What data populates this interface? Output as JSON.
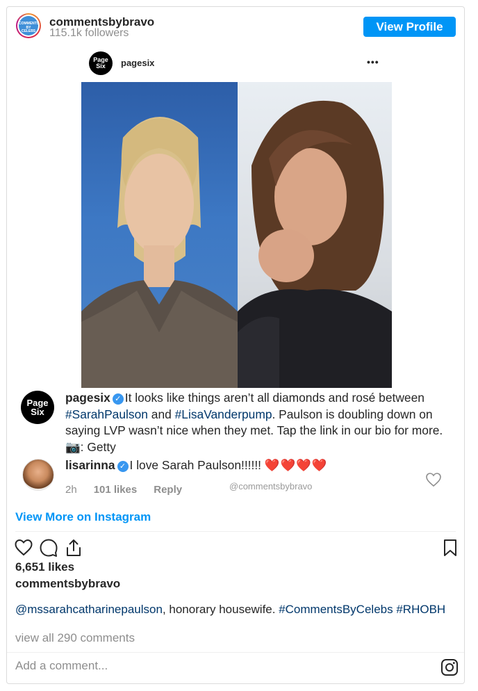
{
  "header": {
    "username": "commentsbybravo",
    "followers": "115.1k followers",
    "avatar_text": "COMMENTS BY CELEBS",
    "view_profile_label": "View Profile"
  },
  "inner_post": {
    "avatar_text": "Page Six",
    "username": "pagesix",
    "more_label": "•••"
  },
  "caption": {
    "avatar_text": "Page Six",
    "username": "pagesix",
    "text_1": "It looks like things aren’t all diamonds and rosé between ",
    "tag_1": "#SarahPaulson",
    "text_2": " and ",
    "tag_2": "#LisaVanderpump",
    "text_3": ". Paulson is doubling down on saying LVP wasn’t nice when they met. Tap the link in our bio for more. 📷: Getty"
  },
  "comment": {
    "username": "lisarinna",
    "text": "I love Sarah Paulson!!!!!!",
    "hearts": "❤️❤️❤️❤️",
    "time": "2h",
    "likes": "101 likes",
    "reply_label": "Reply",
    "watermark": "@commentsbybravo"
  },
  "view_more_label": "View More on Instagram",
  "post": {
    "likes": "6,651 likes",
    "owner": "commentsbybravo",
    "mention": "@mssarahcatharinepaulson",
    "caption_text": ", honorary housewife. ",
    "tag_1": "#CommentsByCelebs",
    "tag_2": "#RHOBH",
    "view_all_comments": "view all 290 comments"
  },
  "add_comment_placeholder": "Add a comment...",
  "colors": {
    "accent": "#0095f6",
    "hashtag": "#00376b",
    "muted": "#8e8e8e",
    "verified": "#3897f0"
  }
}
